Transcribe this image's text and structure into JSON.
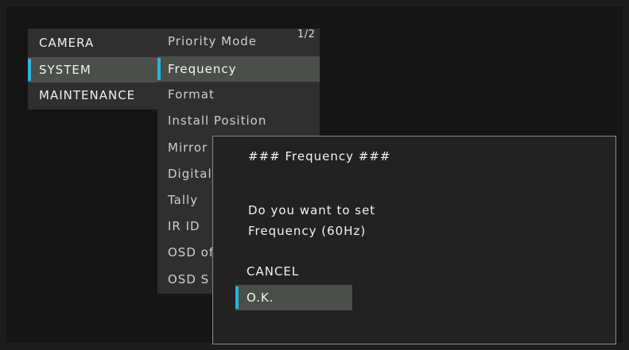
{
  "category_menu": {
    "items": [
      {
        "label": "CAMERA",
        "selected": false
      },
      {
        "label": "SYSTEM",
        "selected": true
      },
      {
        "label": "MAINTENANCE",
        "selected": false
      }
    ]
  },
  "sub_menu": {
    "page_indicator": "1/2",
    "items": [
      {
        "label": "Priority Mode",
        "selected": false
      },
      {
        "label": "Frequency",
        "selected": true
      },
      {
        "label": "Format",
        "selected": false
      },
      {
        "label": "Install Position",
        "selected": false
      },
      {
        "label": "Mirror",
        "selected": false
      },
      {
        "label": "Digital",
        "selected": false
      },
      {
        "label": "Tally",
        "selected": false
      },
      {
        "label": "IR ID",
        "selected": false
      },
      {
        "label": "OSD of",
        "selected": false
      },
      {
        "label": "OSD S",
        "selected": false
      }
    ]
  },
  "dialog": {
    "title": "### Frequency ###",
    "message_line1": "Do you want to set",
    "message_line2": "Frequency (60Hz)",
    "cancel_label": "CANCEL",
    "ok_label": "O.K."
  },
  "colors": {
    "accent": "#26b6d9",
    "menu_bg": "#2f2f2f",
    "selected_bg": "#4a4f4a"
  }
}
